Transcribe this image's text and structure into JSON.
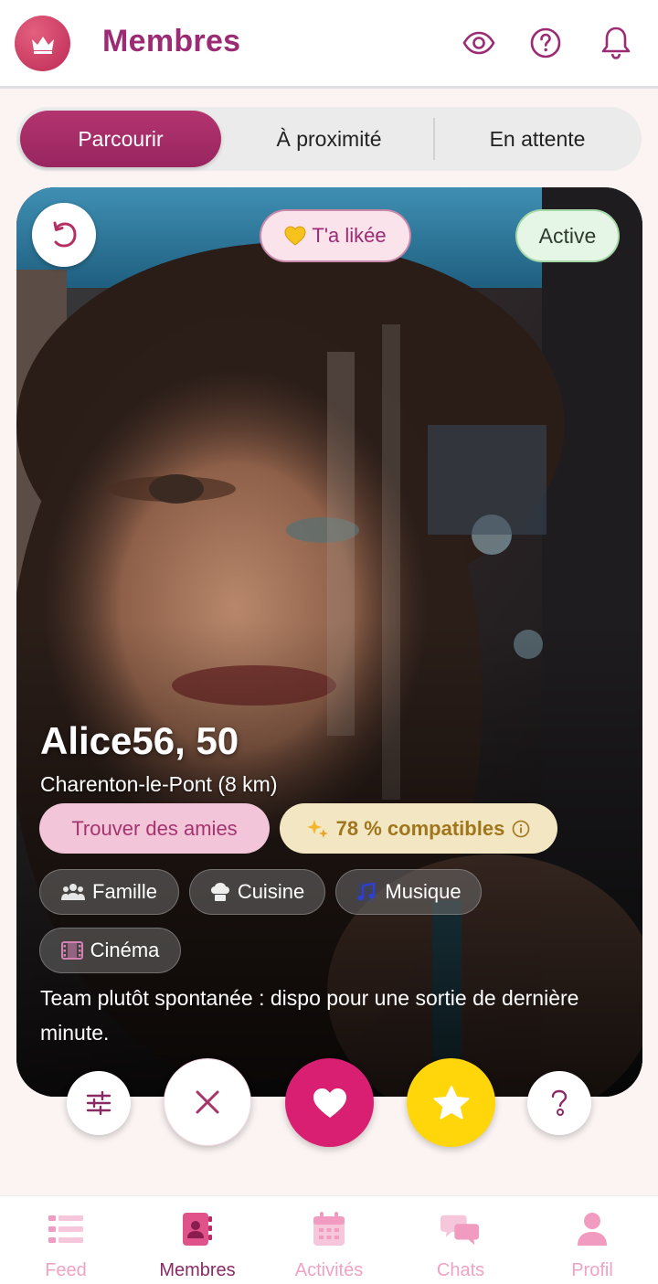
{
  "header": {
    "title": "Membres",
    "icons": [
      "crown-icon",
      "eye-icon",
      "help-circle-icon",
      "bell-icon"
    ]
  },
  "tabs": [
    {
      "label": "Parcourir",
      "active": true
    },
    {
      "label": "À proximité",
      "active": false
    },
    {
      "label": "En attente",
      "active": false
    }
  ],
  "profile": {
    "liked_badge": "T'a likée",
    "status": "Active",
    "name_age": "Alice56, 50",
    "location": "Charenton-le-Pont (8 km)",
    "goal": "Trouver des amies",
    "compatibility": "78 % compatibles",
    "interests": [
      {
        "label": "Famille",
        "icon": "family-icon"
      },
      {
        "label": "Cuisine",
        "icon": "chef-hat-icon"
      },
      {
        "label": "Musique",
        "icon": "music-note-icon"
      },
      {
        "label": "Cinéma",
        "icon": "film-icon"
      }
    ],
    "bio": "Team plutôt spontanée : dispo pour une sortie de dernière minute."
  },
  "actions": [
    "filters-icon",
    "close-icon",
    "heart-icon",
    "star-icon",
    "question-icon"
  ],
  "nav": [
    {
      "label": "Feed",
      "icon": "list-icon",
      "active": false
    },
    {
      "label": "Membres",
      "icon": "contacts-icon",
      "active": true
    },
    {
      "label": "Activités",
      "icon": "calendar-icon",
      "active": false
    },
    {
      "label": "Chats",
      "icon": "chat-bubbles-icon",
      "active": false
    },
    {
      "label": "Profil",
      "icon": "person-icon",
      "active": false
    }
  ],
  "colors": {
    "brand": "#9b2b73",
    "tab_active": "#a82d68",
    "like": "#d91f72",
    "superlike": "#ffd60a",
    "nav_inactive": "#efa3c3"
  }
}
